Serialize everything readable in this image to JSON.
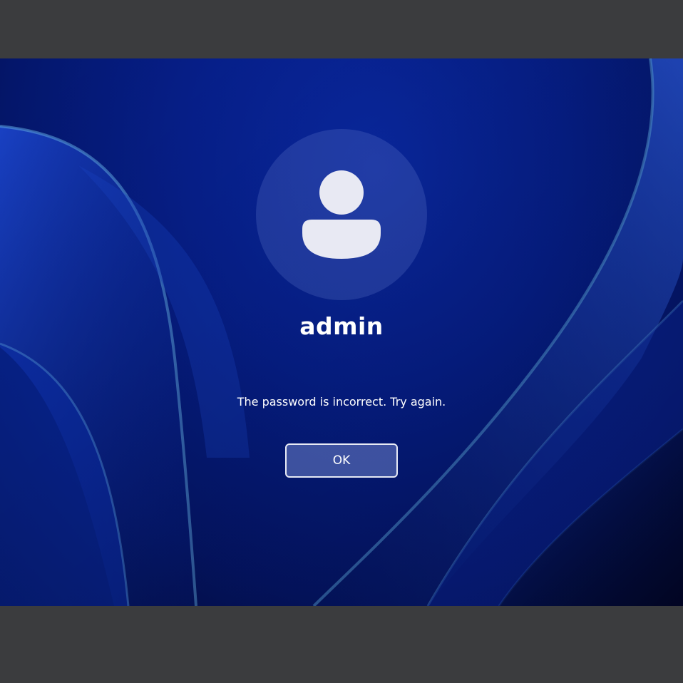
{
  "lock_screen": {
    "username": "admin",
    "message": "The password is incorrect. Try again.",
    "ok_label": "OK",
    "avatar_icon": "user-avatar-icon"
  },
  "colors": {
    "letterbox": "#3b3c3e",
    "wallpaper_base": "#06208f",
    "text": "#ffffff",
    "avatar_glyph": "#e8e9f3"
  }
}
